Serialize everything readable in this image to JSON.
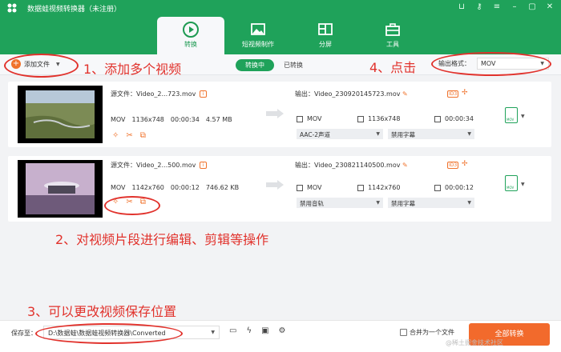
{
  "app": {
    "title": "数据蛙视频转换器（未注册）",
    "window_controls": [
      "cart-icon",
      "key-icon",
      "menu-icon",
      "minimize-icon",
      "restore-icon",
      "close-icon"
    ]
  },
  "tabs": [
    {
      "label": "转换",
      "icon": "convert-icon",
      "active": true
    },
    {
      "label": "短视频制作",
      "icon": "image-icon",
      "active": false
    },
    {
      "label": "分屏",
      "icon": "split-screen-icon",
      "active": false
    },
    {
      "label": "工具",
      "icon": "toolbox-icon",
      "active": false
    }
  ],
  "toolbar": {
    "add_file": "添加文件",
    "seg_converting": "转换中",
    "seg_converted": "已转换",
    "output_format_label": "输出格式：",
    "output_format_value": "MOV"
  },
  "annotations": {
    "a1": "1、添加多个视频",
    "a2": "2、对视频片段进行编辑、剪辑等操作",
    "a3": "3、可以更改视频保存位置",
    "a4": "4、点击"
  },
  "videos": [
    {
      "source": "源文件：Video_2...723.mov",
      "format": "MOV",
      "resolution": "1136x748",
      "duration": "00:00:34",
      "size": "4.57 MB",
      "output_name": "输出：Video_230920145723.mov",
      "out_format": "MOV",
      "out_resolution": "1136x748",
      "out_duration": "00:00:34",
      "audio": "AAC-2声道",
      "subtitle": "禁用字幕"
    },
    {
      "source": "源文件：Video_2...500.mov",
      "format": "MOV",
      "resolution": "1142x760",
      "duration": "00:00:12",
      "size": "746.62 KB",
      "output_name": "输出：Video_230821140500.mov",
      "out_format": "MOV",
      "out_resolution": "1142x760",
      "out_duration": "00:00:12",
      "audio": "禁用音轨",
      "subtitle": "禁用字幕"
    }
  ],
  "bottom": {
    "save_label": "保存至：",
    "save_path": "D:\\数据蛙\\数据蛙视频转换器\\Converted",
    "merge_label": "合并为一个文件",
    "convert_all": "全部转换",
    "watermark": "@稀土掘金技术社区"
  },
  "colors": {
    "brand_green": "#1fa25a",
    "accent_orange": "#f26a2c",
    "annotation_red": "#e1322c"
  }
}
